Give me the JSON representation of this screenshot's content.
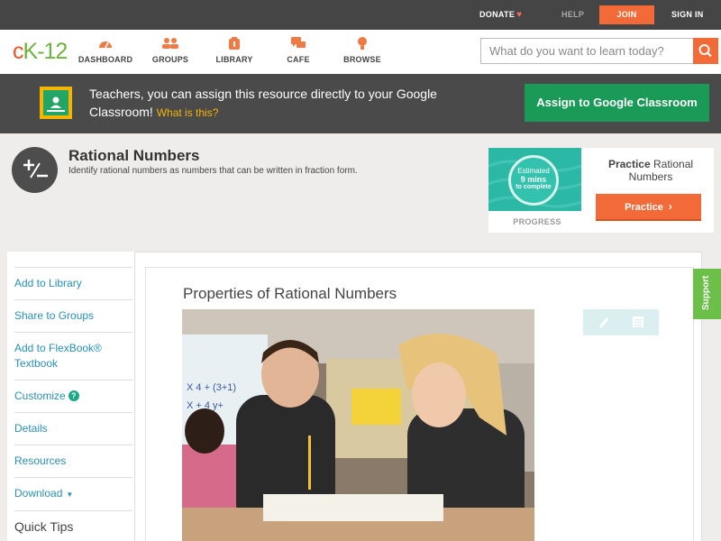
{
  "topbar": {
    "donate": "DONATE",
    "help": "HELP",
    "join": "JOIN",
    "signin": "SIGN IN"
  },
  "nav": {
    "logo": {
      "c": "c",
      "k": "K",
      "n": "-12"
    },
    "items": [
      {
        "label": "DASHBOARD",
        "icon": "dashboard-icon"
      },
      {
        "label": "GROUPS",
        "icon": "groups-icon"
      },
      {
        "label": "LIBRARY",
        "icon": "library-icon"
      },
      {
        "label": "CAFE",
        "icon": "cafe-icon"
      },
      {
        "label": "BROWSE",
        "icon": "browse-icon"
      }
    ],
    "search_placeholder": "What do you want to learn today?"
  },
  "banner": {
    "line": "Teachers, you can assign this resource directly to your Google Classroom!",
    "what": "What is this?",
    "assign": "Assign to Google Classroom"
  },
  "concept": {
    "title": "Rational Numbers",
    "subtitle": "Identify rational numbers as numbers that can be written in fraction form."
  },
  "practice": {
    "est1": "Estimated",
    "est2": "9 mins",
    "est3": "to complete",
    "progress": "PROGRESS",
    "title_bold": "Practice",
    "title_rest": "Rational Numbers",
    "button": "Practice"
  },
  "sidebar": {
    "items": [
      {
        "label": "Add to Library"
      },
      {
        "label": "Share to Groups"
      },
      {
        "label": "Add to FlexBook® Textbook"
      },
      {
        "label": "Customize"
      },
      {
        "label": "Details"
      },
      {
        "label": "Resources"
      },
      {
        "label": "Download"
      }
    ],
    "tips": "Quick Tips"
  },
  "article": {
    "title": "Properties of Rational Numbers"
  },
  "support": "Support",
  "colors": {
    "accent": "#f26a37",
    "green": "#1a9a57",
    "teal": "#2bb9a6",
    "link": "#2a8fb5"
  }
}
